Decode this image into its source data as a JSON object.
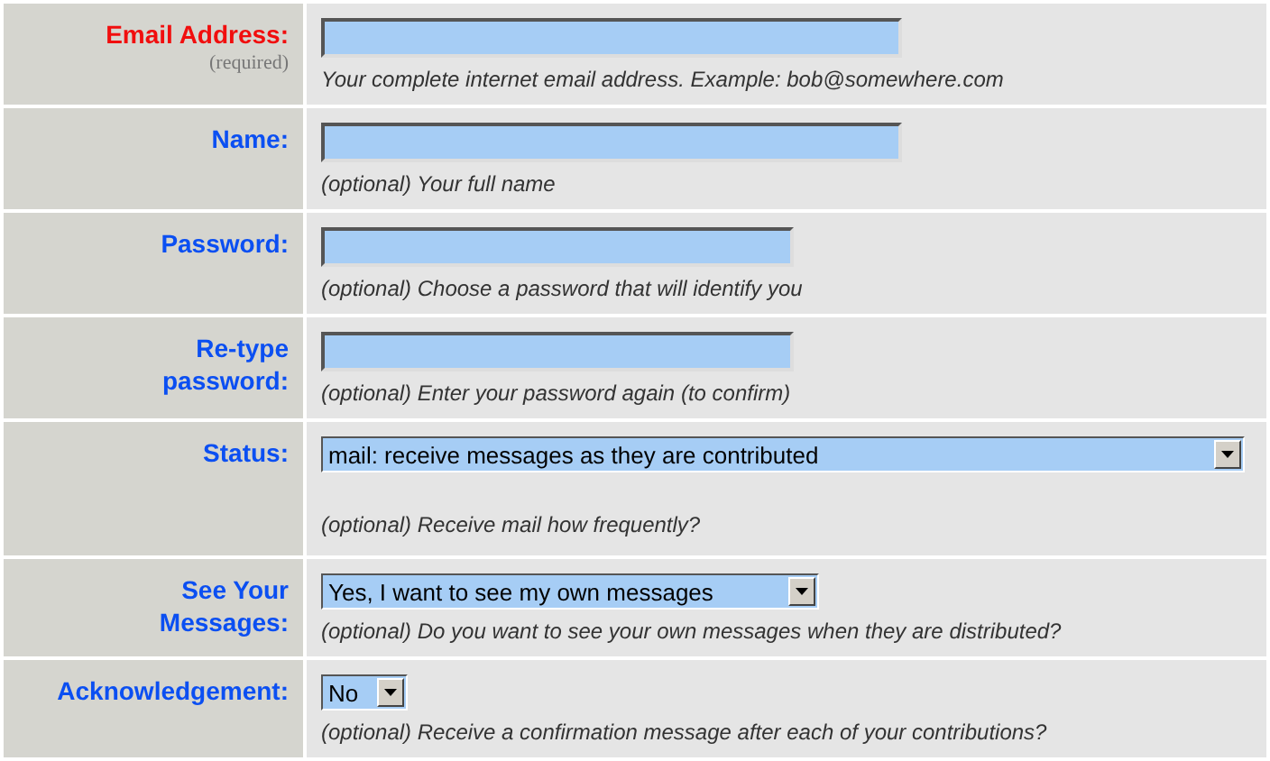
{
  "rows": [
    {
      "label": "Email Address:",
      "required": true,
      "note": "(required)",
      "field": {
        "kind": "text"
      },
      "hint": "Your complete internet email address. Example: bob@somewhere.com"
    },
    {
      "label": "Name:",
      "required": false,
      "field": {
        "kind": "text"
      },
      "hint": "(optional) Your full name"
    },
    {
      "label": "Password:",
      "required": false,
      "field": {
        "kind": "password"
      },
      "hint": "(optional) Choose a password that will identify you"
    },
    {
      "label": "Re-type password:",
      "required": false,
      "field": {
        "kind": "password"
      },
      "hint": "(optional) Enter your password again (to confirm)"
    },
    {
      "label": "Status:",
      "required": false,
      "field": {
        "kind": "select",
        "value": "mail: receive messages as they are contributed"
      },
      "hint": "(optional) Receive mail how frequently?"
    },
    {
      "label": "See Your Messages:",
      "required": false,
      "field": {
        "kind": "select",
        "value": "Yes, I want to see my own messages"
      },
      "hint": "(optional) Do you want to see your own messages when they are distributed?"
    },
    {
      "label": "Acknowledgement:",
      "required": false,
      "field": {
        "kind": "select",
        "value": "No"
      },
      "hint": "(optional) Receive a confirmation message after each of your contributions?"
    }
  ]
}
